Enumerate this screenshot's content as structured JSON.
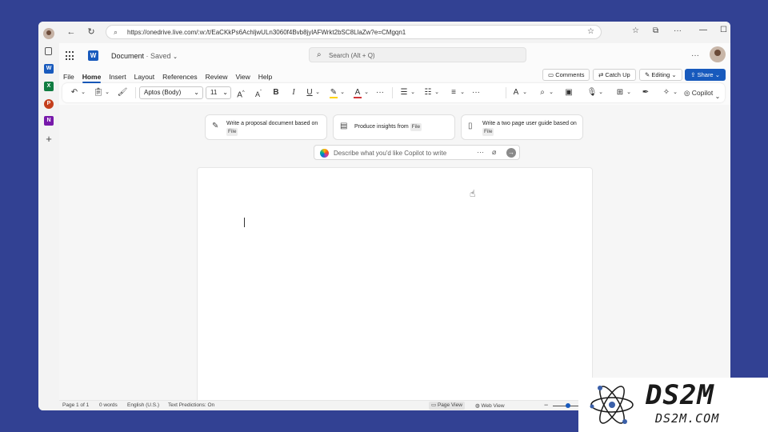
{
  "browser": {
    "url": "https://onedrive.live.com/:w:/t/EaCKkPs6AchljwULn3060f4Bvb8jylAFWrkt2bSC8LlaZw?e=CMgqn1"
  },
  "app": {
    "doc_name": "Document",
    "saved_status": "· Saved",
    "search_placeholder": "Search (Alt + Q)"
  },
  "tabs": [
    "File",
    "Home",
    "Insert",
    "Layout",
    "References",
    "Review",
    "View",
    "Help"
  ],
  "actions": {
    "comments": "Comments",
    "catch_up": "Catch Up",
    "editing": "Editing",
    "share": "Share"
  },
  "ribbon": {
    "font": "Aptos (Body)",
    "size": "11",
    "bold": "B",
    "italic": "I",
    "underline": "U",
    "copilot": "Copilot",
    "highlight_color": "#ffd400",
    "font_color": "#d13438"
  },
  "prompts": [
    {
      "text": "Write a proposal document based on",
      "chip": "File"
    },
    {
      "text": "Produce insights from",
      "chip": "File"
    },
    {
      "text": "Write a two page user guide based on",
      "chip": "File"
    }
  ],
  "copilot_box": {
    "placeholder": "Describe what you'd like Copilot to write"
  },
  "statusbar": {
    "page": "Page 1 of 1",
    "words": "0 words",
    "language": "English (U.S.)",
    "predictions": "Text Predictions: On",
    "page_view": "Page View",
    "web_view": "Web View"
  },
  "watermark": {
    "title": "DS2M",
    "subtitle": "DS2M.COM"
  },
  "colors": {
    "background": "#324193",
    "word_blue": "#185abd"
  }
}
